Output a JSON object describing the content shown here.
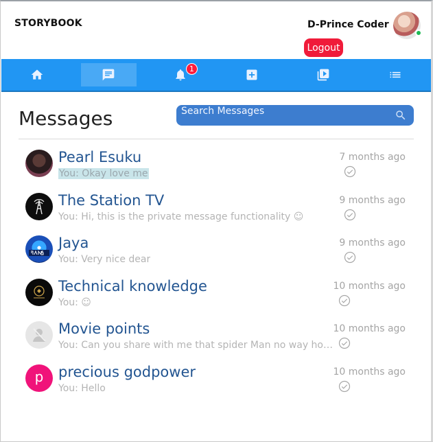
{
  "app": {
    "brand": "STORYBOOK",
    "user_name": "D-Prince Coder",
    "logout_label": "Logout"
  },
  "nav": {
    "items": [
      {
        "name": "home",
        "icon": "home-icon",
        "active": false
      },
      {
        "name": "messages",
        "icon": "chat-icon",
        "active": true
      },
      {
        "name": "notifications",
        "icon": "bell-icon",
        "active": false,
        "badge": "1"
      },
      {
        "name": "add-post",
        "icon": "add-box-icon",
        "active": false
      },
      {
        "name": "videos",
        "icon": "video-library-icon",
        "active": false
      },
      {
        "name": "list",
        "icon": "list-icon",
        "active": false
      }
    ]
  },
  "messages": {
    "title": "Messages",
    "search_placeholder": "Search Messages",
    "items": [
      {
        "name": "Pearl Esuku",
        "preview": "You: Okay love me",
        "time": "7 months ago",
        "avatar": "photo-dark",
        "highlight": true
      },
      {
        "name": "The Station TV",
        "preview": "You: Hi, this is the private message functionality ☺",
        "time": "9 months ago",
        "avatar": "tower-logo"
      },
      {
        "name": "Jaya",
        "preview": "You: Very nice dear",
        "time": "9 months ago",
        "avatar": "fans-logo"
      },
      {
        "name": "Technical knowledge",
        "preview": "You: ☺",
        "time": "10 months ago",
        "avatar": "gold-emblem"
      },
      {
        "name": "Movie points",
        "preview": "You: Can you share with me that spider Man no way home...",
        "time": "10 months ago",
        "avatar": "placeholder-person"
      },
      {
        "name": "precious godpower",
        "preview": "You: Hello",
        "time": "10 months ago",
        "avatar": "letter",
        "avatar_letter": "p",
        "avatar_color": "#f0137a"
      }
    ]
  },
  "colors": {
    "nav_blue": "#2196f3",
    "search_blue": "#3d7dcf",
    "logout_red": "#f01b3a",
    "name_blue": "#235591",
    "online_green": "#1db954"
  }
}
